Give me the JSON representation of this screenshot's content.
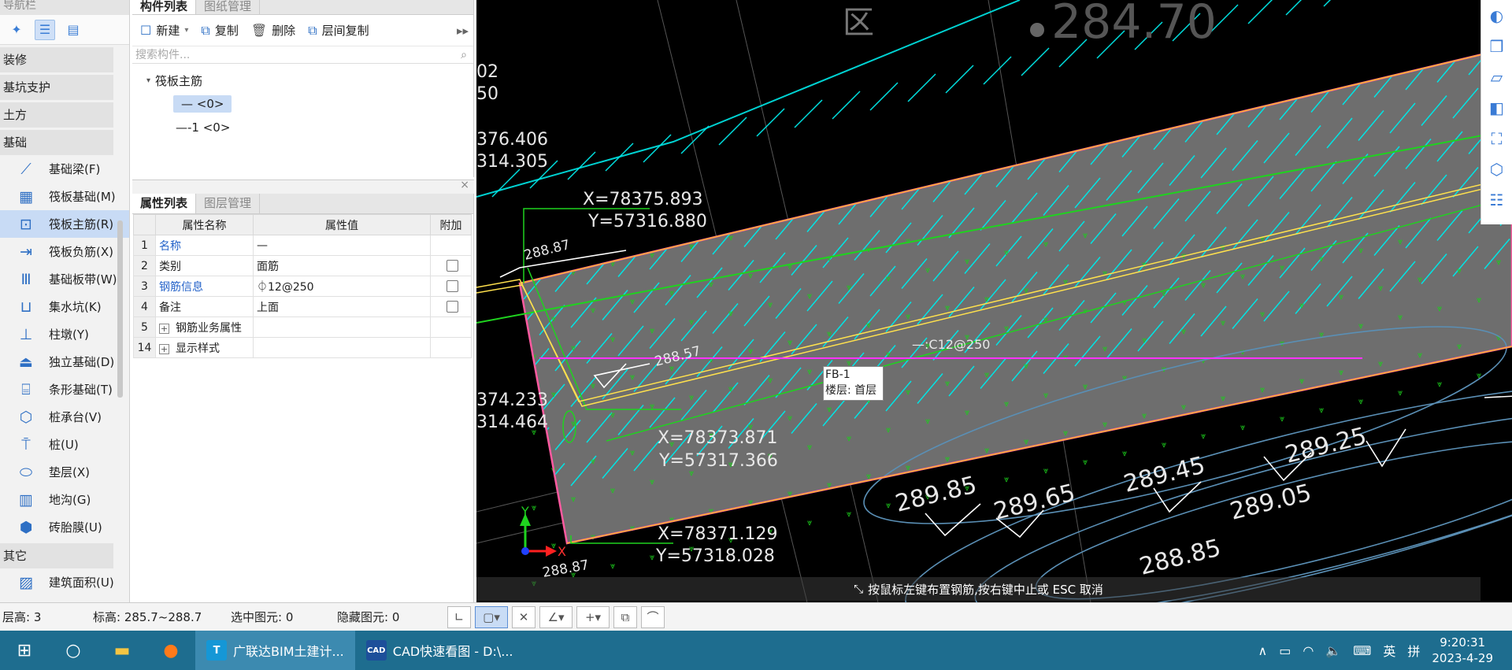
{
  "nav": {
    "title": "导航栏",
    "categories": {
      "c1": "装修",
      "c2": "基坑支护",
      "c3": "土方",
      "c4": "基础",
      "c5": "其它"
    },
    "items": [
      {
        "label": "基础梁(F)",
        "icon": "beam-icon"
      },
      {
        "label": "筏板基础(M)",
        "icon": "raft-foundation-icon"
      },
      {
        "label": "筏板主筋(R)",
        "icon": "raft-main-rebar-icon"
      },
      {
        "label": "筏板负筋(X)",
        "icon": "raft-negative-rebar-icon"
      },
      {
        "label": "基础板带(W)",
        "icon": "foundation-strip-icon"
      },
      {
        "label": "集水坑(K)",
        "icon": "sump-pit-icon"
      },
      {
        "label": "柱墩(Y)",
        "icon": "column-pier-icon"
      },
      {
        "label": "独立基础(D)",
        "icon": "isolated-foundation-icon"
      },
      {
        "label": "条形基础(T)",
        "icon": "strip-foundation-icon"
      },
      {
        "label": "桩承台(V)",
        "icon": "pile-cap-icon"
      },
      {
        "label": "桩(U)",
        "icon": "pile-icon"
      },
      {
        "label": "垫层(X)",
        "icon": "cushion-layer-icon"
      },
      {
        "label": "地沟(G)",
        "icon": "trench-icon"
      },
      {
        "label": "砖胎膜(U)",
        "icon": "brick-mold-icon"
      }
    ],
    "other_item": {
      "label": "建筑面积(U)",
      "icon": "building-area-icon"
    }
  },
  "component_list": {
    "tabs": [
      "构件列表",
      "图纸管理"
    ],
    "toolbar": {
      "new": "新建",
      "copy": "复制",
      "delete": "删除",
      "floor_copy": "层间复制"
    },
    "search_placeholder": "搜索构件...",
    "tree": {
      "root": "筏板主筋",
      "child1": "— <0>",
      "child2": "—-1 <0>"
    }
  },
  "properties": {
    "tabs": [
      "属性列表",
      "图层管理"
    ],
    "headers": {
      "name": "属性名称",
      "value": "属性值",
      "extra": "附加"
    },
    "rows": [
      {
        "no": "1",
        "name": "名称",
        "value": "—"
      },
      {
        "no": "2",
        "name": "类别",
        "value": "面筋"
      },
      {
        "no": "3",
        "name": "钢筋信息",
        "value": "⏀12@250"
      },
      {
        "no": "4",
        "name": "备注",
        "value": "上面"
      },
      {
        "no": "5",
        "name": "钢筋业务属性",
        "value": ""
      },
      {
        "no": "14",
        "name": "显示样式",
        "value": ""
      }
    ]
  },
  "canvas": {
    "labels": {
      "top_large": "284.70",
      "area_char": "区",
      "l1": "02",
      "l2": "50",
      "l3": "376.406",
      "l4": "314.305",
      "coord1_x": "X=78375.893",
      "coord1_y": "Y=57316.880",
      "coord2_x": "X=78373.871",
      "coord2_y": "Y=57317.366",
      "coord3_x": "X=78371.129",
      "coord3_y": "Y=57318.028",
      "dim1": "288.87",
      "dim2": "288.57",
      "dim3": "288.87",
      "l5": "374.233",
      "l6": "314.464",
      "rebar_label": "—:C12@250",
      "e1": "289.85",
      "e2": "289.65",
      "e3": "289.45",
      "e4": "289.25",
      "e5": "289.05",
      "e6": "288.85",
      "axis_y": "Y",
      "axis_x": "X"
    },
    "tooltip": {
      "line1": "FB-1",
      "line2": "楼层: 首层"
    },
    "hint": "按鼠标左键布置钢筋,按右键中止或 ESC 取消"
  },
  "status_bar": {
    "floor_height": "层高:  3",
    "elevation": "标高:   285.7~288.7",
    "selected": "选中图元:  0",
    "hidden": "隐藏图元:  0"
  },
  "taskbar": {
    "apps": [
      {
        "label": "广联达BIM土建计...",
        "icon": "T"
      },
      {
        "label": "CAD快速看图 - D:\\...",
        "icon": "CAD"
      }
    ],
    "ime": "英",
    "ime2": "拼",
    "time": "9:20:31",
    "date": "2023-4-29"
  },
  "colors": {
    "canvas_bg": "#000000",
    "taskbar": "#1e6d8f",
    "accent": "#2e6fc4",
    "rebar_cyan": "#00e5e5",
    "slab_fill": "#6e6e6e"
  }
}
